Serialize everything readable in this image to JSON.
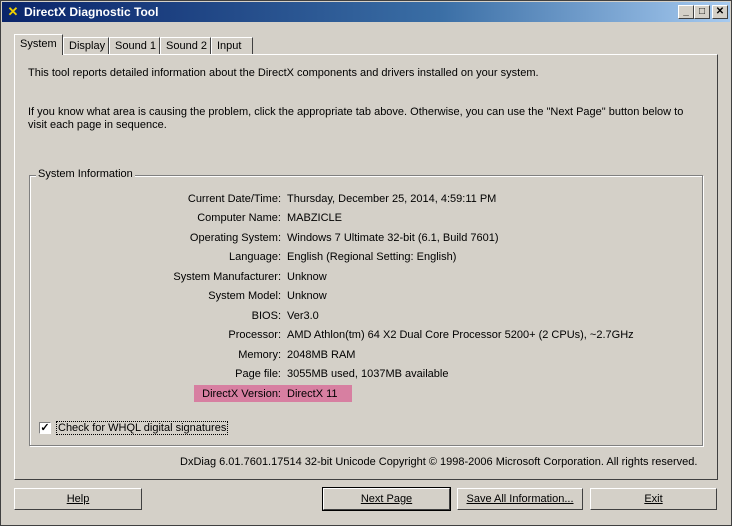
{
  "window": {
    "title": "DirectX Diagnostic Tool"
  },
  "tabs": [
    "System",
    "Display",
    "Sound 1",
    "Sound 2",
    "Input"
  ],
  "intro": {
    "line1": "This tool reports detailed information about the DirectX components and drivers installed on your system.",
    "line2": "If you know what area is causing the problem, click the appropriate tab above.  Otherwise, you can use the \"Next Page\" button below to",
    "line3": "visit each page in sequence."
  },
  "system_info": {
    "title": "System Information",
    "rows": [
      {
        "label": "Current Date/Time:",
        "value": "Thursday, December 25, 2014, 4:59:11 PM"
      },
      {
        "label": "Computer Name:",
        "value": "MABZICLE"
      },
      {
        "label": "Operating System:",
        "value": "Windows 7 Ultimate 32-bit (6.1, Build 7601)"
      },
      {
        "label": "Language:",
        "value": "English (Regional Setting: English)"
      },
      {
        "label": "System Manufacturer:",
        "value": "Unknow"
      },
      {
        "label": "System Model:",
        "value": "Unknow"
      },
      {
        "label": "BIOS:",
        "value": "Ver3.0"
      },
      {
        "label": "Processor:",
        "value": "AMD Athlon(tm) 64 X2 Dual Core Processor 5200+ (2 CPUs), ~2.7GHz"
      },
      {
        "label": "Memory:",
        "value": "2048MB RAM"
      },
      {
        "label": "Page file:",
        "value": "3055MB used, 1037MB available"
      },
      {
        "label": "DirectX Version:",
        "value": "DirectX 11"
      }
    ],
    "highlight_color": "#d77fa1"
  },
  "whql": {
    "label": "Check for WHQL digital signatures",
    "checked": true
  },
  "footer": "DxDiag 6.01.7601.17514 32-bit Unicode  Copyright © 1998-2006 Microsoft Corporation.  All rights reserved.",
  "buttons": {
    "help": "Help",
    "next_page": "Next Page",
    "save_all": "Save All Information...",
    "exit": "Exit"
  },
  "colors": {
    "face": "#d4d0c8",
    "title_start": "#0a246a",
    "title_end": "#a6caf0"
  }
}
